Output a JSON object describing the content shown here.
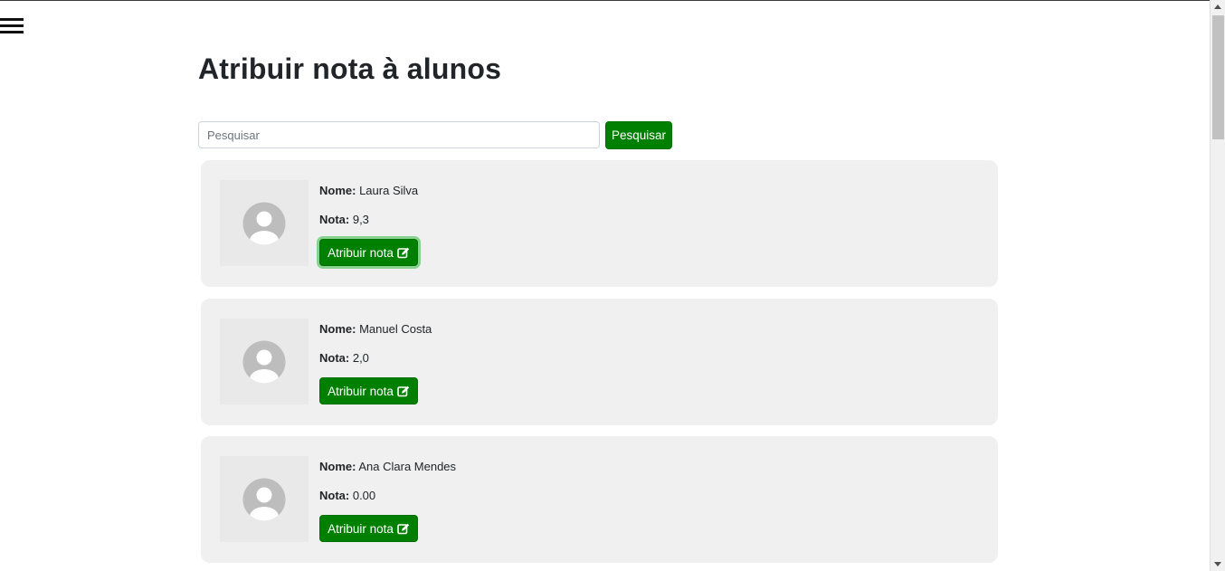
{
  "header": {
    "menu_icon": "hamburger-menu-icon",
    "title": "Atribuir nota à alunos"
  },
  "search": {
    "placeholder": "Pesquisar",
    "value": "",
    "button_label": "Pesquisar"
  },
  "students": [
    {
      "name_label": "Nome:",
      "name": "Laura Silva",
      "grade_label": "Nota:",
      "grade": "9,3",
      "button_label": "Atribuir nota",
      "avatar_icon": "user-avatar-icon",
      "edit_icon": "edit-icon"
    },
    {
      "name_label": "Nome:",
      "name": "Manuel Costa",
      "grade_label": "Nota:",
      "grade": "2,0",
      "button_label": "Atribuir nota",
      "avatar_icon": "user-avatar-icon",
      "edit_icon": "edit-icon"
    },
    {
      "name_label": "Nome:",
      "name": "Ana Clara Mendes",
      "grade_label": "Nota:",
      "grade": "0.00",
      "button_label": "Atribuir nota",
      "avatar_icon": "user-avatar-icon",
      "edit_icon": "edit-icon"
    }
  ],
  "colors": {
    "accent": "#008000",
    "card_background": "#f0f0f0",
    "avatar_placeholder": "#bdbdbd"
  }
}
